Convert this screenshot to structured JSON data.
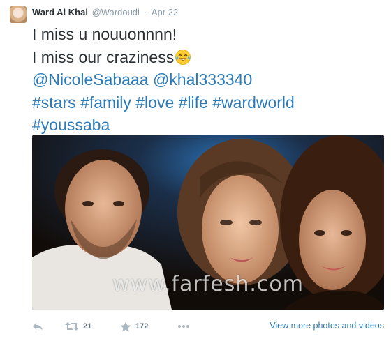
{
  "tweet": {
    "author_name": "Ward Al Khal",
    "author_handle": "@Wardoudi",
    "separator": "·",
    "timestamp": "Apr 22",
    "lines": [
      "I miss u nouuonnnn!",
      "I miss our craziness"
    ],
    "mentions_line": "@NicoleSabaaa @khal333340",
    "hashtags_line": "#stars #family #love #life #wardworld",
    "hashtags_line_2": "#youssaba",
    "emoji_name": "face-with-tears-of-joy",
    "photo_watermark": "www.farfesh.com"
  },
  "actions": {
    "reply_icon": "reply-icon",
    "retweet_icon": "retweet-icon",
    "retweet_count": "21",
    "favorite_icon": "star-icon",
    "favorite_count": "172",
    "more_icon": "ellipsis-icon",
    "media_link": "View more photos and videos"
  },
  "colors": {
    "link": "#2b7bb9",
    "muted": "#8899a6",
    "text": "#292f33"
  }
}
